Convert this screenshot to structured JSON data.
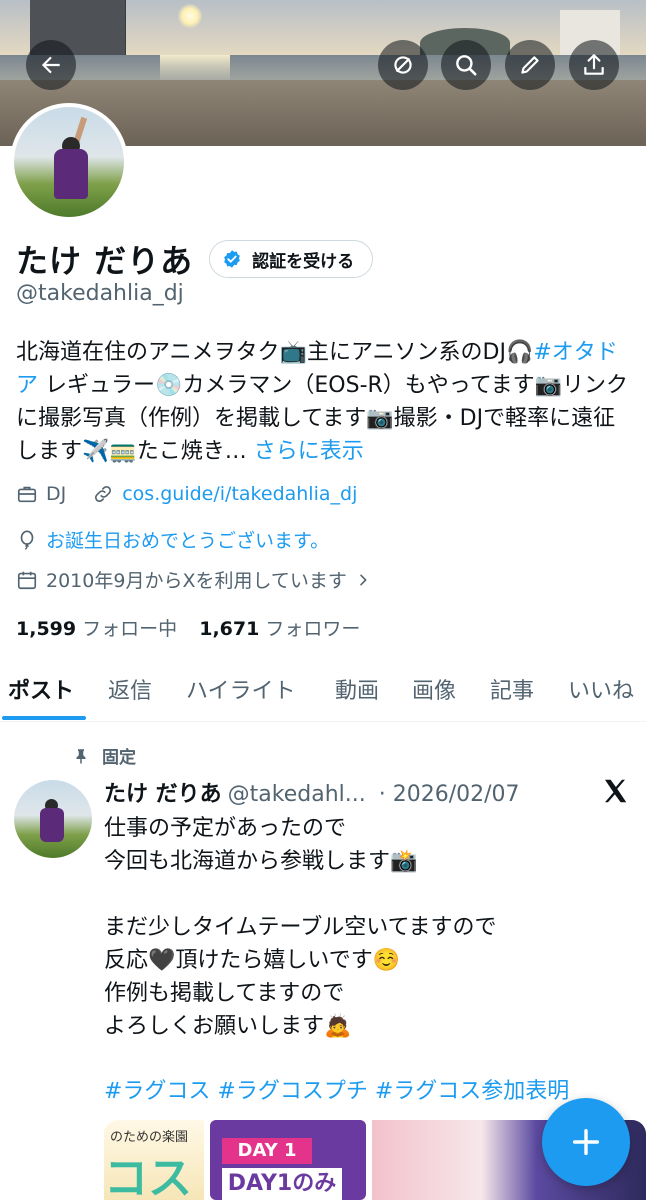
{
  "colors": {
    "accent": "#1d9bf0",
    "text": "#0f1419",
    "secondary": "#536471"
  },
  "header": {
    "icons": [
      "back-arrow-icon",
      "grok-icon",
      "search-icon",
      "edit-pencil-icon",
      "share-upload-icon"
    ]
  },
  "profile": {
    "display_name": "たけ だりあ",
    "verify_button": "認証を受ける",
    "handle": "@takedahlia_dj",
    "bio": {
      "line1": "北海道在住のアニメヲタク📺主にアニソン系のDJ🎧",
      "hashtag": "#オタドア",
      "line2": " レギュラー💿カメラマン（EOS-R）もやってます📷リンクに撮影写真（作例）を掲載してます📷撮影・DJで軽率に遠征します✈️🚃たこ焼き… ",
      "more": "さらに表示"
    },
    "category": "DJ",
    "link": "cos.guide/i/takedahlia_dj",
    "birthday": "お誕生日おめでとうございます。",
    "joined": "2010年9月からXを利用しています",
    "following_count": "1,599",
    "following_label": "フォロー中",
    "followers_count": "1,671",
    "followers_label": "フォロワー"
  },
  "tabs": [
    "ポスト",
    "返信",
    "ハイライト",
    "動画",
    "画像",
    "記事",
    "いいね"
  ],
  "post": {
    "pinned_label": "固定",
    "name": "たけ だりあ",
    "handle": "@takedahl...",
    "date": "· 2026/02/07",
    "lines": [
      "仕事の予定があったので",
      "今回も北海道から参戦します📸",
      "",
      "まだ少しタイムテーブル空いてますので",
      "反応🖤頂けたら嬉しいです☺️",
      "作例も掲載してますので",
      "よろしくお願いします🙇"
    ],
    "hashtags": "#ラグコス #ラグコスプチ #ラグコス参加表明",
    "media": {
      "m1_top": "のための楽園",
      "m1_big": "コス",
      "m2_day": "DAY 1",
      "m2_sub": "DAY1のみ"
    }
  },
  "fab": {
    "icon": "plus-icon"
  }
}
